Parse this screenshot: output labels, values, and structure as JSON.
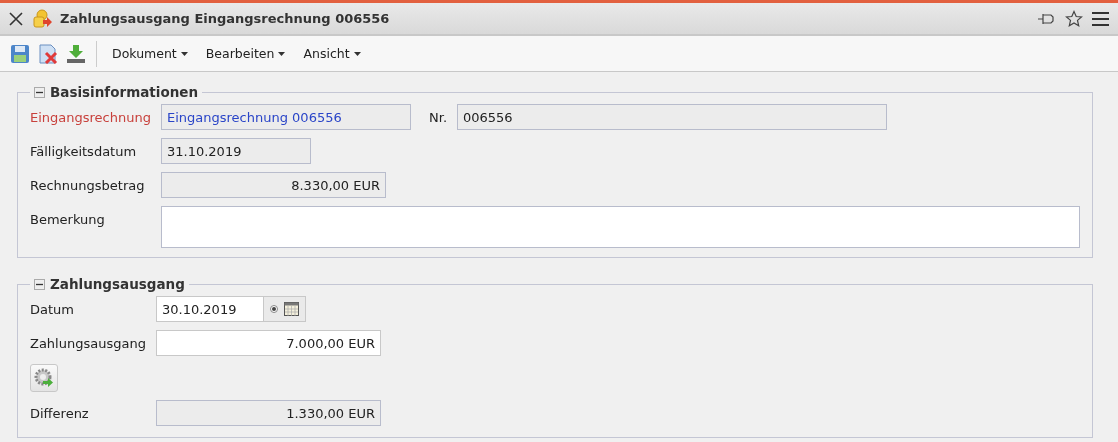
{
  "window": {
    "title": "Zahlungsausgang Eingangsrechnung 006556"
  },
  "menus": [
    {
      "label": "Dokument"
    },
    {
      "label": "Bearbeiten"
    },
    {
      "label": "Ansicht"
    }
  ],
  "sections": [
    {
      "title": "Basisinformationen",
      "expanded": true,
      "rows": [
        {
          "kind": "link",
          "label": "Eingangsrechnung",
          "value": "Eingangsrechnung 006556",
          "editable": false,
          "extra": {
            "label": "Nr.",
            "value": "006556"
          }
        },
        {
          "kind": "date",
          "label": "Fälligkeitsdatum",
          "value": "31.10.2019",
          "editable": false
        },
        {
          "kind": "amount",
          "label": "Rechnungsbetrag",
          "value": "8.330,00 EUR",
          "editable": false
        },
        {
          "kind": "textarea",
          "label": "Bemerkung",
          "editable": true
        }
      ]
    },
    {
      "title": "Zahlungsausgang",
      "expanded": true,
      "rows": [
        {
          "kind": "datepicker",
          "label": "Datum",
          "value": "30.10.2019",
          "editable": true
        },
        {
          "kind": "amount",
          "label": "Zahlungsausgang",
          "value": "7.000,00 EUR",
          "editable": true
        },
        {
          "kind": "action"
        },
        {
          "kind": "amount",
          "label": "Differenz",
          "value": "1.330,00 EUR",
          "editable": false
        }
      ]
    }
  ]
}
